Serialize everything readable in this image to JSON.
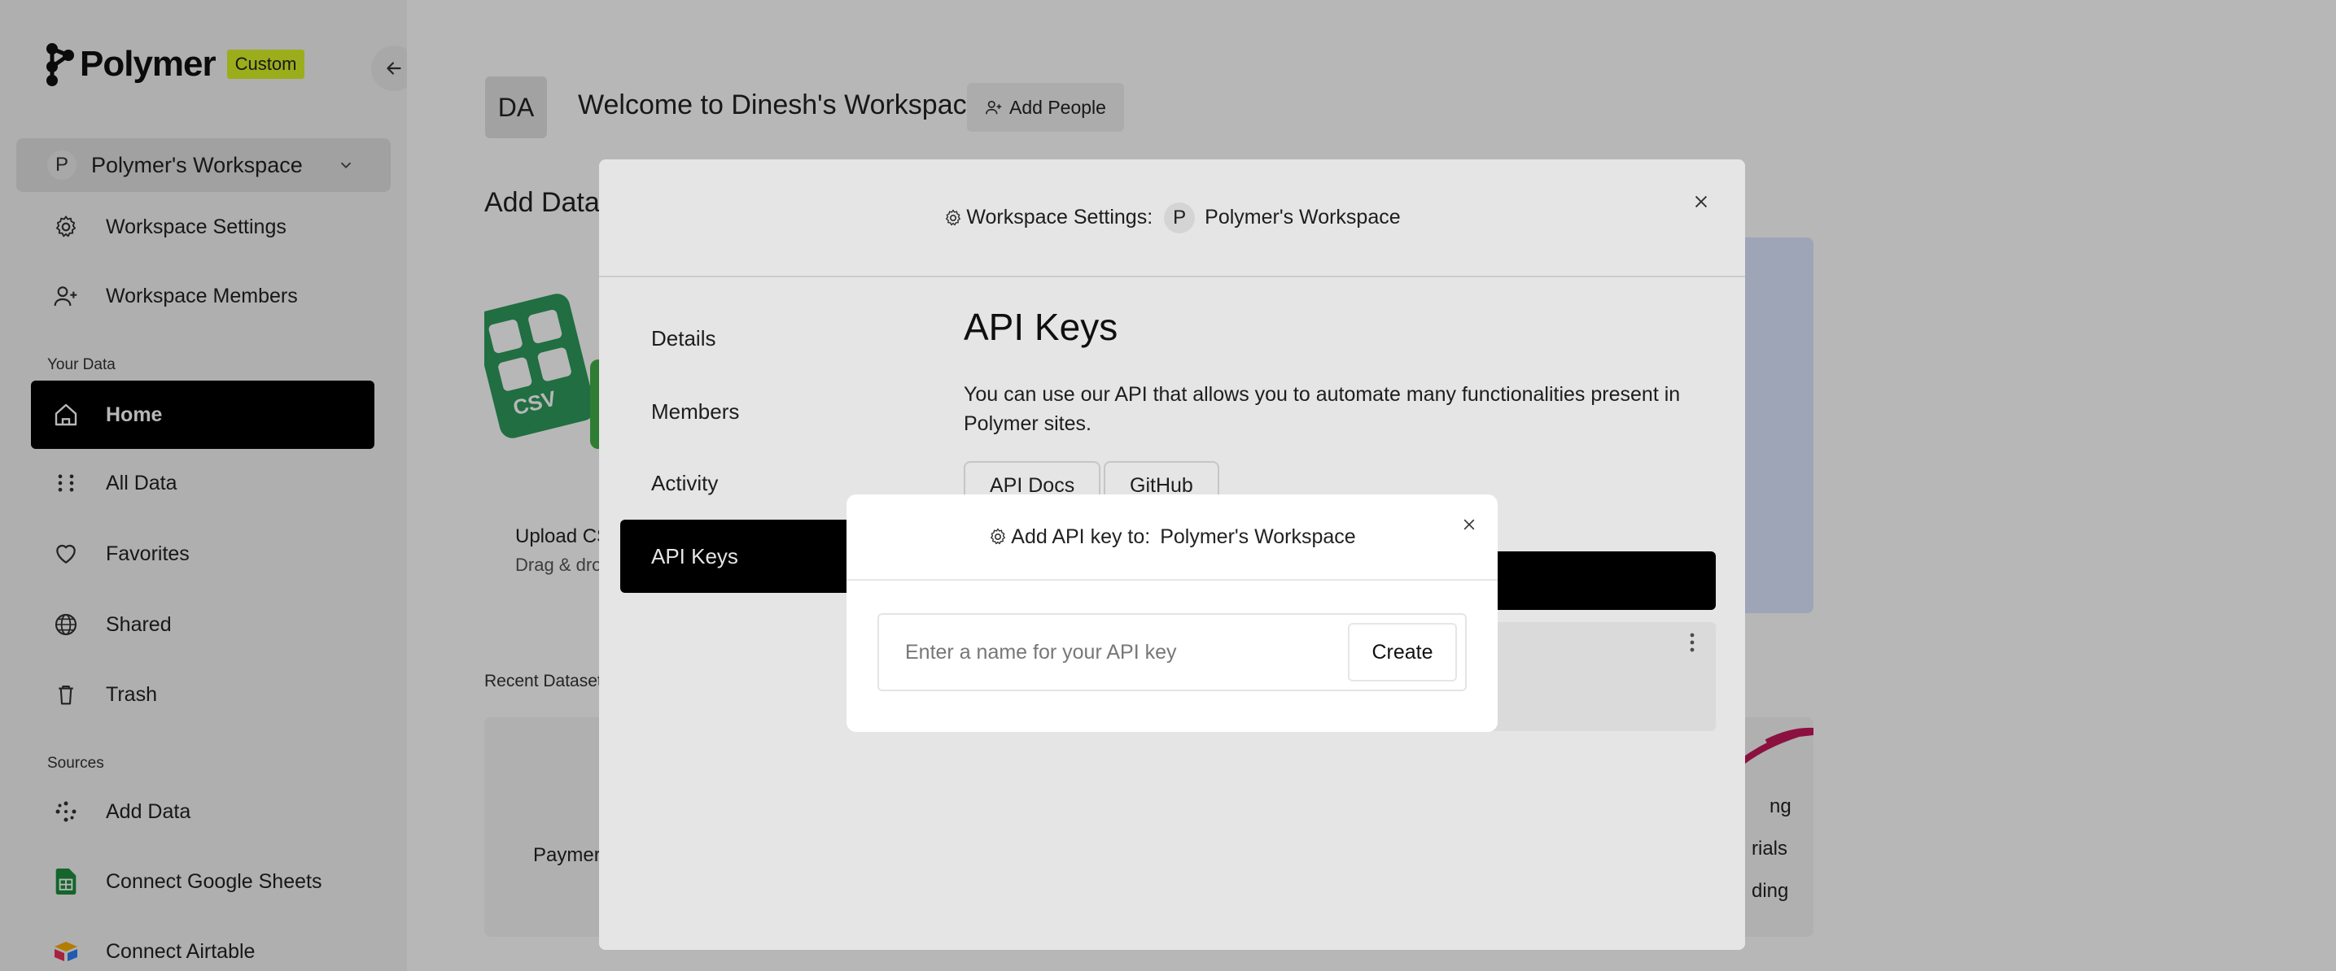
{
  "brand": {
    "name": "Polymer",
    "badge": "Custom"
  },
  "sidebar": {
    "workspace": {
      "avatar": "P",
      "name": "Polymer's Workspace"
    },
    "top_items": [
      {
        "label": "Workspace Settings",
        "icon": "gear-icon"
      },
      {
        "label": "Workspace Members",
        "icon": "user-plus-icon"
      }
    ],
    "your_data_label": "Your Data",
    "data_items": [
      {
        "label": "Home",
        "icon": "home-icon",
        "active": true
      },
      {
        "label": "All Data",
        "icon": "grid-dots-icon"
      },
      {
        "label": "Favorites",
        "icon": "heart-icon"
      },
      {
        "label": "Shared",
        "icon": "globe-icon"
      },
      {
        "label": "Trash",
        "icon": "trash-icon"
      }
    ],
    "sources_label": "Sources",
    "source_items": [
      {
        "label": "Add Data",
        "icon": "dots-plus-icon"
      },
      {
        "label": "Connect Google Sheets",
        "icon": "google-sheets-icon"
      },
      {
        "label": "Connect Airtable",
        "icon": "airtable-icon"
      }
    ]
  },
  "header": {
    "avatar": "DA",
    "welcome": "Welcome to Dinesh's Workspace",
    "add_people": "Add People"
  },
  "main": {
    "add_data_title": "Add Data",
    "csv_card": {
      "tile_label": "CSV",
      "title": "Upload CS",
      "subtitle": "Drag & dro"
    },
    "recent_label": "Recent Dataset",
    "recent_left": "Paymer",
    "recent_right": [
      "ng",
      "rials",
      "ding"
    ]
  },
  "settings_modal": {
    "title_prefix": "Workspace Settings:",
    "workspace_avatar": "P",
    "workspace_name": "Polymer's Workspace",
    "nav": [
      {
        "label": "Details"
      },
      {
        "label": "Members"
      },
      {
        "label": "Activity"
      },
      {
        "label": "API Keys",
        "active": true
      }
    ],
    "api_keys": {
      "title": "API Keys",
      "description": "You can use our API that allows you to automate many functionalities present in Polymer sites.",
      "docs_button": "API Docs",
      "github_button": "GitHub"
    }
  },
  "api_dialog": {
    "title_prefix": "Add API key to:",
    "workspace_name": "Polymer's Workspace",
    "input_placeholder": "Enter a name for your API key",
    "input_value": "",
    "create_button": "Create"
  },
  "colors": {
    "accent_badge": "#d9f227",
    "active_nav": "#000000",
    "csv_green": "#2d9a5c",
    "airtable_pink": "#c2185b"
  }
}
